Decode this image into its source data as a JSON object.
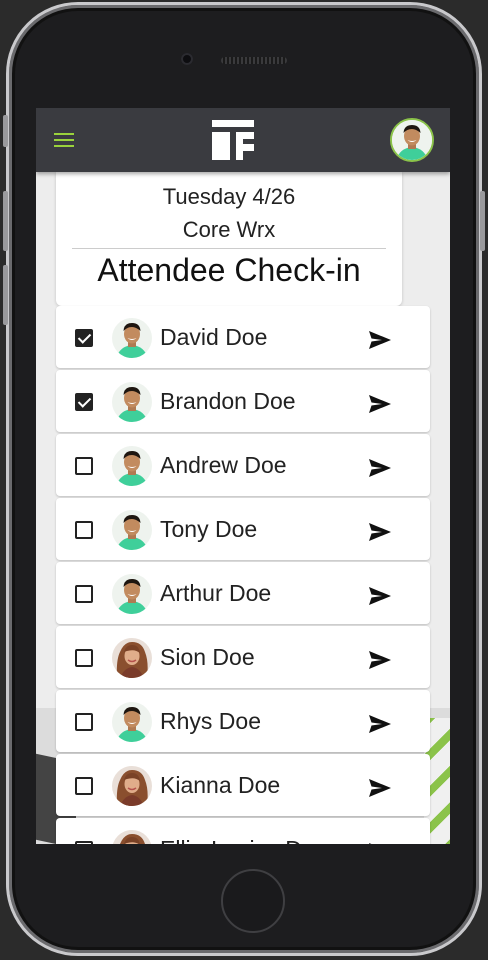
{
  "app": {
    "logo": "TF"
  },
  "header": {
    "date": "Tuesday 4/26",
    "class_name": "Core Wrx",
    "title": "Attendee Check-in"
  },
  "attendees": [
    {
      "name": "David Doe",
      "checked": true,
      "avatar": "male"
    },
    {
      "name": "Brandon Doe",
      "checked": true,
      "avatar": "male"
    },
    {
      "name": "Andrew Doe",
      "checked": false,
      "avatar": "male"
    },
    {
      "name": "Tony Doe",
      "checked": false,
      "avatar": "male"
    },
    {
      "name": "Arthur Doe",
      "checked": false,
      "avatar": "male"
    },
    {
      "name": "Sion Doe",
      "checked": false,
      "avatar": "female"
    },
    {
      "name": "Rhys Doe",
      "checked": false,
      "avatar": "male"
    },
    {
      "name": "Kianna Doe",
      "checked": false,
      "avatar": "female"
    },
    {
      "name": "Ellie-Louise Doe",
      "checked": false,
      "avatar": "female"
    }
  ],
  "colors": {
    "accent": "#8bc34a",
    "appbar": "#3a3b40",
    "shirt": "#3fcf9a"
  },
  "icons": {
    "menu": "hamburger-icon",
    "send": "send-icon",
    "check": "checkbox-icon"
  }
}
